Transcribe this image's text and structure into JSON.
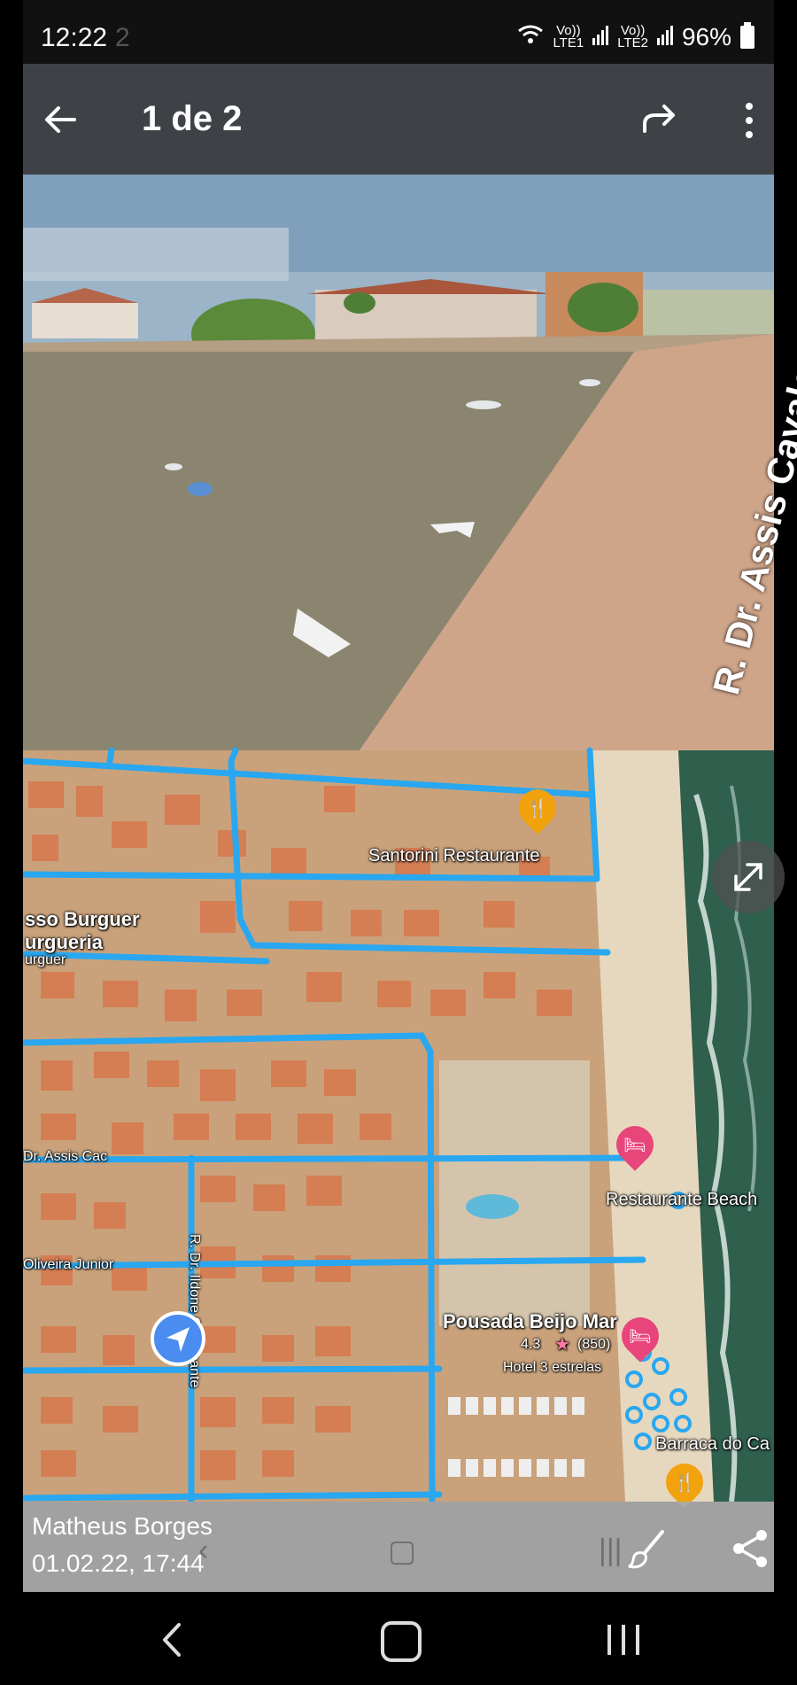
{
  "status_bar": {
    "time": "12:22",
    "faded_text": "2",
    "net1_top": "Vo))",
    "net1_bottom": "LTE1",
    "net2_top": "Vo))",
    "net2_bottom": "LTE2",
    "battery": "96%"
  },
  "app_bar": {
    "title": "1 de 2"
  },
  "street_view": {
    "street_label": "R. Dr. Assis Cavalcante"
  },
  "map": {
    "labels": {
      "santorini": "Santorini Restaurante",
      "burguer1": "sso Burguer",
      "burguer2": "urgueria",
      "burguer3": "urguer",
      "assis": "Dr. Assis Cac",
      "ildone": "R. Dr. Ildone Cavalcante",
      "oliveira": "Oliveira Junior",
      "beach": "Restaurante Beach",
      "pousada": "Pousada Beijo Mar",
      "rating": "4.3",
      "reviews": "(850)",
      "hotel": "Hotel 3 estrelas",
      "barraca": "Barraca do Ca"
    }
  },
  "info_bar": {
    "author": "Matheus Borges",
    "date": "01.02.22, 17:44"
  },
  "colors": {
    "road": "#29a7f0",
    "pin_food": "#f2a20c",
    "pin_hotel": "#e8457b",
    "nav_dot": "#4a8cf0"
  }
}
